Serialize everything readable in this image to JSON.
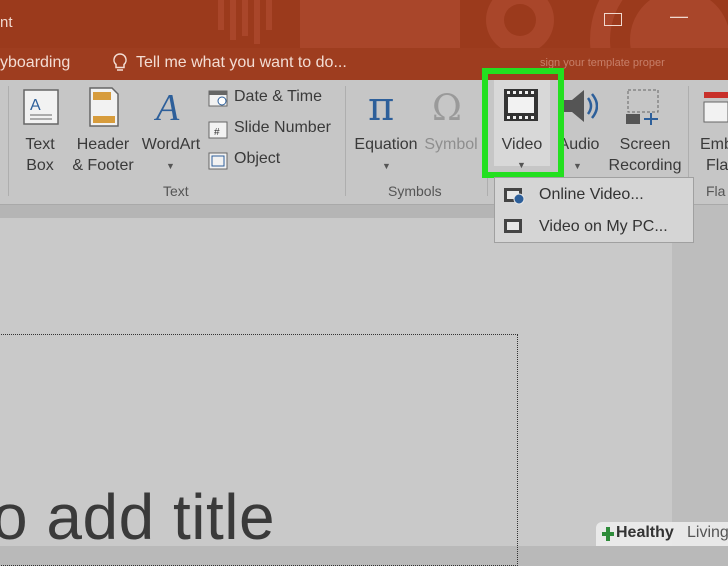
{
  "titlebar": {
    "app_title": "nt",
    "colors": {
      "bar": "#9b3a1c",
      "text": "#f1d9cf"
    }
  },
  "tellbar": {
    "tab_label": "yboarding",
    "tell_me": "Tell me what you want to do...",
    "signin_hint": "sign your template proper"
  },
  "ribbon": {
    "text_group": {
      "label": "Text",
      "text_box": [
        "Text",
        "Box"
      ],
      "header_footer": [
        "Header",
        "& Footer"
      ],
      "wordart": "WordArt",
      "date_time": "Date & Time",
      "slide_number": "Slide Number",
      "object": "Object"
    },
    "symbols_group": {
      "label": "Symbols",
      "equation": "Equation",
      "symbol": "Symbol"
    },
    "media_group": {
      "video": "Video",
      "audio": "Audio",
      "screen_recording": [
        "Screen",
        "Recording"
      ]
    },
    "flash_group": {
      "embed": [
        "Emb",
        "Flas"
      ],
      "label": "Fla"
    }
  },
  "dropdown": {
    "items": [
      {
        "label": "Online Video..."
      },
      {
        "label": "Video on My PC..."
      }
    ]
  },
  "slide": {
    "title_placeholder": "o add title"
  },
  "watermark": {
    "bold": "Healthy",
    "thin": "Living"
  },
  "colors": {
    "highlight": "#23e01f",
    "accent_blue": "#2d5f9a"
  }
}
